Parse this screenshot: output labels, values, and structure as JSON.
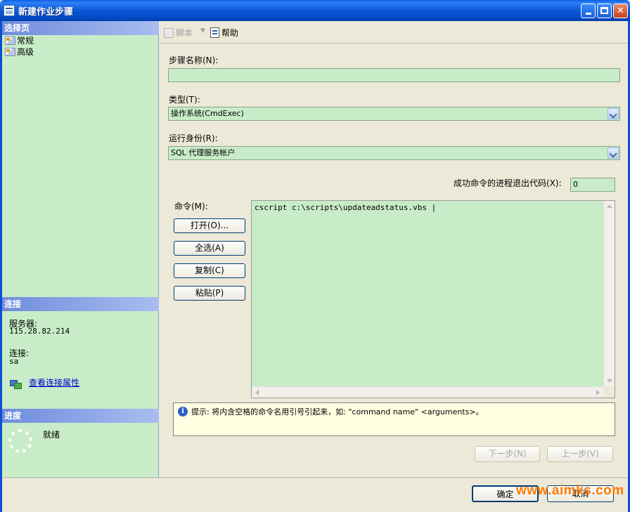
{
  "window": {
    "title": "新建作业步骤"
  },
  "sidebar": {
    "pages_header": "选择页",
    "pages": [
      {
        "label": "常规"
      },
      {
        "label": "高级"
      }
    ],
    "connection_header": "连接",
    "server_label": "服务器:",
    "server_value": "115.28.82.214",
    "connection_label": "连接:",
    "connection_value": "sa",
    "view_connection_link": "查看连接属性",
    "progress_header": "进度",
    "progress_status": "就绪"
  },
  "toolbar": {
    "script_label": "脚本",
    "help_label": "帮助"
  },
  "form": {
    "step_name_label": "步骤名称(N):",
    "step_name_value": "",
    "type_label": "类型(T):",
    "type_value": "操作系统(CmdExec)",
    "run_as_label": "运行身份(R):",
    "run_as_value": "SQL 代理服务帐户",
    "exit_code_label": "成功命令的进程退出代码(X):",
    "exit_code_value": "0",
    "command_label": "命令(M):",
    "command_text": "cscript c:\\scripts\\updateadstatus.vbs |",
    "open_button": "打开(O)...",
    "select_all_button": "全选(A)",
    "copy_button": "复制(C)",
    "paste_button": "粘贴(P)",
    "hint_text": "提示: 将内含空格的命令名用引号引起来，如: \"command name\" <arguments>。",
    "next_button": "下一步(N)",
    "prev_button": "上一步(V)"
  },
  "footer": {
    "ok_button": "确定",
    "cancel_button": "取消",
    "watermark": "www.aimks.com"
  },
  "colors": {
    "title_bar": "#0a58d6",
    "field_bg": "#c8ecc8",
    "section_header": "#6f8ddc",
    "hint_bg": "#ffffe1",
    "watermark": "#ff7a00"
  }
}
